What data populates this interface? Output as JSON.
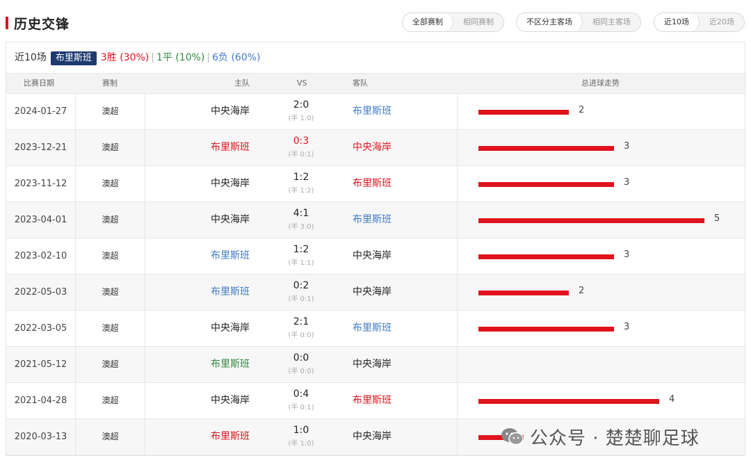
{
  "header": {
    "title": "历史交锋",
    "filters": [
      {
        "options": [
          "全部赛制",
          "相同赛制"
        ],
        "active": 0
      },
      {
        "options": [
          "不区分主客场",
          "相同主客场"
        ],
        "active": 0
      },
      {
        "options": [
          "近10场",
          "近20场"
        ],
        "active": 0
      }
    ]
  },
  "summary": {
    "label": "近10场",
    "team": "布里斯班",
    "win": "3胜 (30%)",
    "draw": "1平 (10%)",
    "loss": "6负 (60%)",
    "sep": "|"
  },
  "table": {
    "columns": {
      "date": "比赛日期",
      "competition": "赛制",
      "home": "主队",
      "vs": "VS",
      "away": "客队",
      "trend": "总进球走势"
    },
    "rows": [
      {
        "date": "2024-01-27",
        "comp": "澳超",
        "home": "中央海岸",
        "home_color": "black",
        "score": "2:0",
        "score_color": "black",
        "half": "(半 1:0)",
        "half_color": "grey",
        "away": "布里斯班",
        "away_color": "blue",
        "total": "2",
        "total_value": 2
      },
      {
        "date": "2023-12-21",
        "comp": "澳超",
        "home": "布里斯班",
        "home_color": "red",
        "score": "0:3",
        "score_color": "red",
        "half": "(半 0:1)",
        "half_color": "red",
        "away": "中央海岸",
        "away_color": "red",
        "total": "3",
        "total_value": 3
      },
      {
        "date": "2023-11-12",
        "comp": "澳超",
        "home": "中央海岸",
        "home_color": "black",
        "score": "1:2",
        "score_color": "black",
        "half": "(半 1:2)",
        "half_color": "grey",
        "away": "布里斯班",
        "away_color": "red",
        "total": "3",
        "total_value": 3
      },
      {
        "date": "2023-04-01",
        "comp": "澳超",
        "home": "中央海岸",
        "home_color": "black",
        "score": "4:1",
        "score_color": "black",
        "half": "(半 3:0)",
        "half_color": "grey",
        "away": "布里斯班",
        "away_color": "blue",
        "total": "5",
        "total_value": 5
      },
      {
        "date": "2023-02-10",
        "comp": "澳超",
        "home": "布里斯班",
        "home_color": "blue",
        "score": "1:2",
        "score_color": "black",
        "half": "(半 1:1)",
        "half_color": "grey",
        "away": "中央海岸",
        "away_color": "black",
        "total": "3",
        "total_value": 3
      },
      {
        "date": "2022-05-03",
        "comp": "澳超",
        "home": "布里斯班",
        "home_color": "blue",
        "score": "0:2",
        "score_color": "black",
        "half": "(半 0:1)",
        "half_color": "grey",
        "away": "中央海岸",
        "away_color": "black",
        "total": "2",
        "total_value": 2
      },
      {
        "date": "2022-03-05",
        "comp": "澳超",
        "home": "中央海岸",
        "home_color": "black",
        "score": "2:1",
        "score_color": "black",
        "half": "(半 0:0)",
        "half_color": "grey",
        "away": "布里斯班",
        "away_color": "blue",
        "total": "3",
        "total_value": 3
      },
      {
        "date": "2021-05-12",
        "comp": "澳超",
        "home": "布里斯班",
        "home_color": "green",
        "score": "0:0",
        "score_color": "black",
        "half": "(半 0:0)",
        "half_color": "grey",
        "away": "中央海岸",
        "away_color": "black",
        "total": "",
        "total_value": 0
      },
      {
        "date": "2021-04-28",
        "comp": "澳超",
        "home": "中央海岸",
        "home_color": "black",
        "score": "0:4",
        "score_color": "black",
        "half": "(半 0:1)",
        "half_color": "grey",
        "away": "布里斯班",
        "away_color": "red",
        "total": "4",
        "total_value": 4
      },
      {
        "date": "2020-03-13",
        "comp": "澳超",
        "home": "布里斯班",
        "home_color": "red",
        "score": "1:0",
        "score_color": "black",
        "half": "(半 1:0)",
        "half_color": "grey",
        "away": "中央海岸",
        "away_color": "black",
        "total": "",
        "total_value": 1
      }
    ]
  },
  "watermark": {
    "text": "公众号 · 楚楚聊足球",
    "icon": "wechat-icon"
  },
  "colors": {
    "accent_red": "#e0131c",
    "blue": "#3f7bc8",
    "green": "#2e8b3e",
    "navy": "#1e3a6e"
  }
}
